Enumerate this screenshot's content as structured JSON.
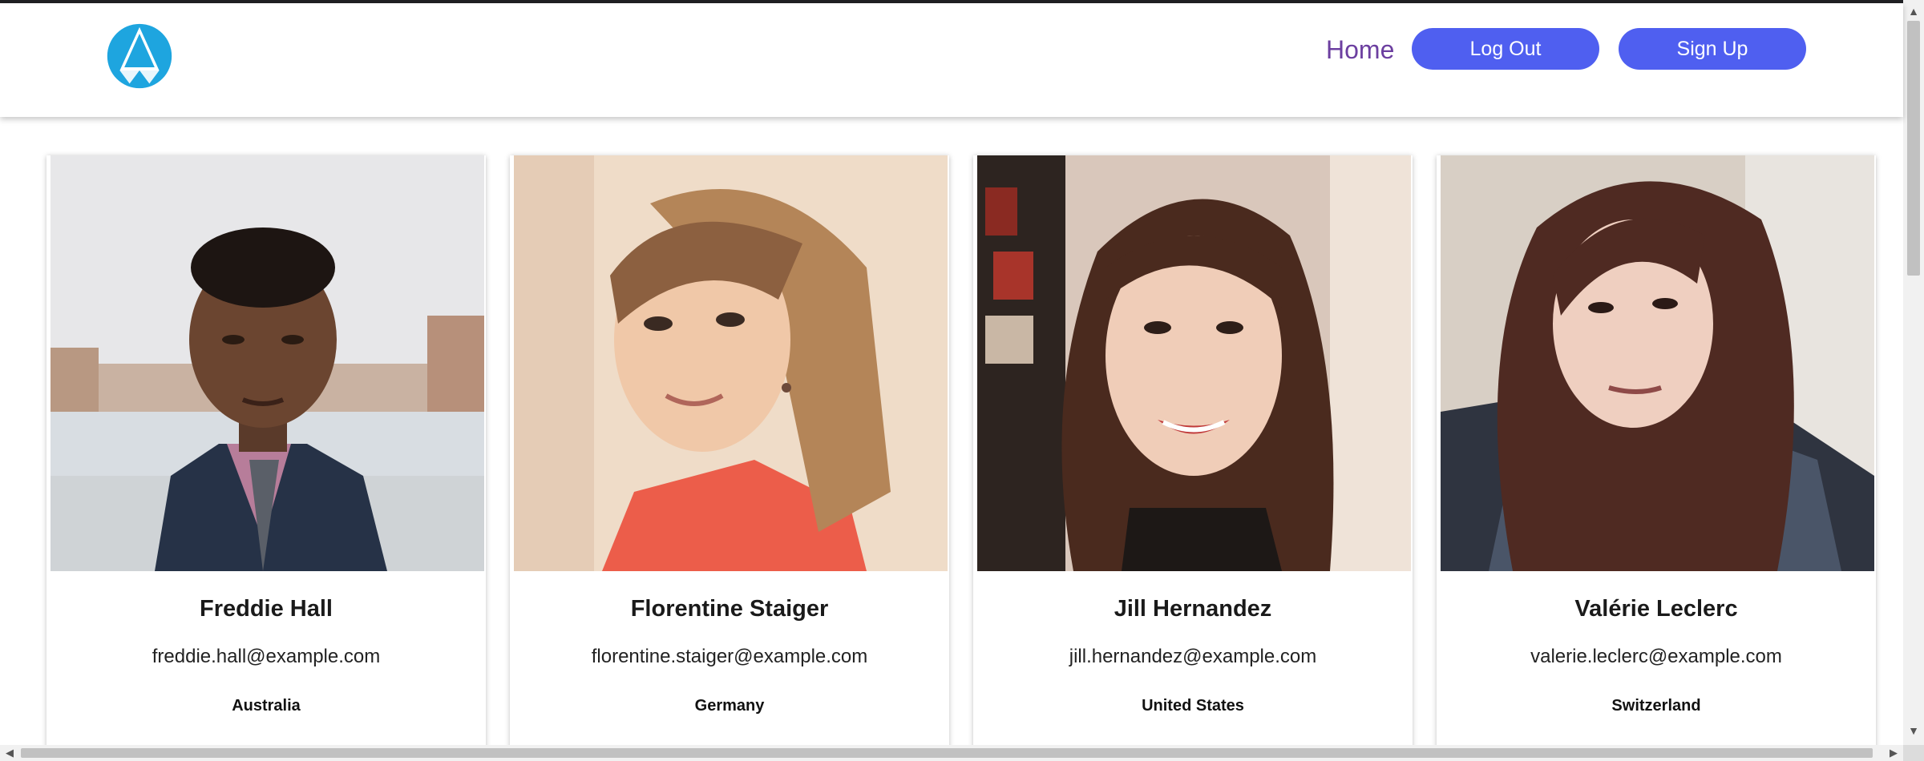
{
  "header": {
    "logo_icon": "aperture-triangle-logo",
    "nav": {
      "home_label": "Home",
      "logout_label": "Log Out",
      "signup_label": "Sign Up"
    }
  },
  "users": [
    {
      "name": "Freddie Hall",
      "email": "freddie.hall@example.com",
      "country": "Australia"
    },
    {
      "name": "Florentine Staiger",
      "email": "florentine.staiger@example.com",
      "country": "Germany"
    },
    {
      "name": "Jill Hernandez",
      "email": "jill.hernandez@example.com",
      "country": "United States"
    },
    {
      "name": "Valérie Leclerc",
      "email": "valerie.leclerc@example.com",
      "country": "Switzerland"
    }
  ],
  "colors": {
    "accent": "#4f5ff0",
    "home_link": "#6c3fa0",
    "logo": "#1ea5df"
  },
  "scrollbars": {
    "up_arrow": "▲",
    "down_arrow": "▼",
    "left_arrow": "◀",
    "right_arrow": "▶"
  }
}
